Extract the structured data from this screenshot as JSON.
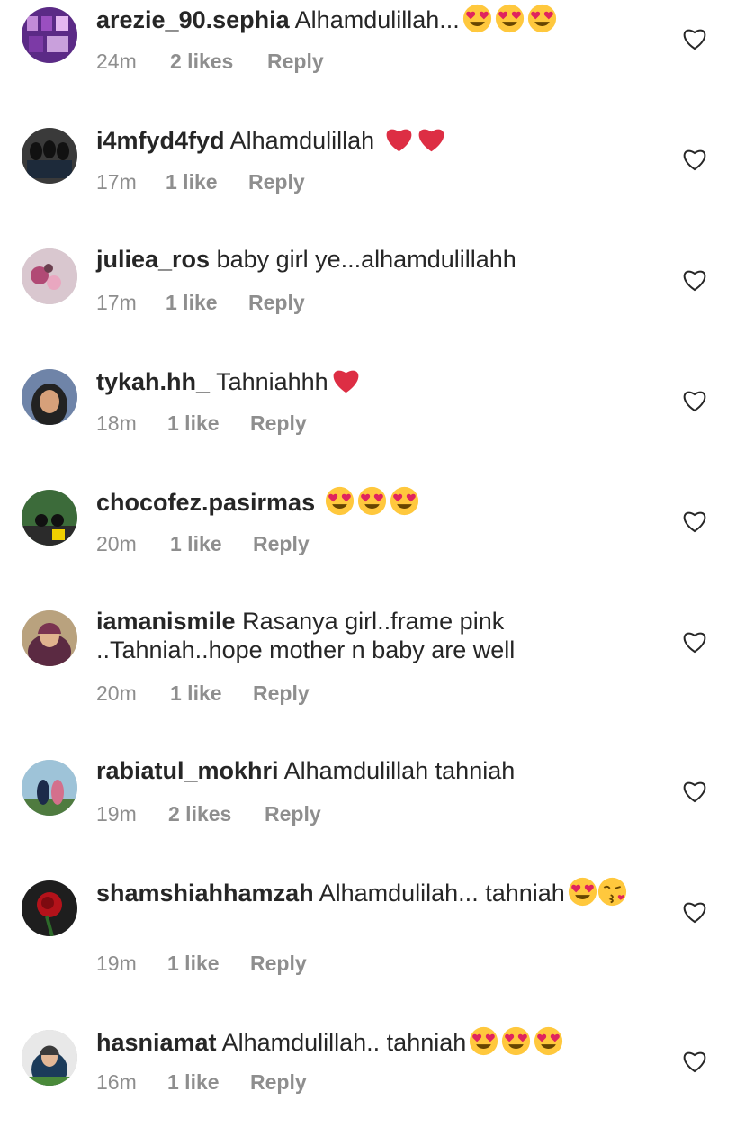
{
  "comments": [
    {
      "username": "arezie_90.sephia",
      "text": "Alhamdulillah...",
      "emojis": [
        "heart-eyes",
        "heart-eyes",
        "heart-eyes"
      ],
      "time": "24m",
      "likes": "2 likes",
      "reply": "Reply"
    },
    {
      "username": "i4mfyd4fyd",
      "text": "Alhamdulillah ",
      "emojis": [
        "red-heart",
        "red-heart"
      ],
      "time": "17m",
      "likes": "1 like",
      "reply": "Reply"
    },
    {
      "username": "juliea_ros",
      "text": "baby girl ye...alhamdulillahh",
      "emojis": [],
      "time": "17m",
      "likes": "1 like",
      "reply": "Reply"
    },
    {
      "username": "tykah.hh_",
      "text": "Tahniahhh",
      "emojis": [
        "red-heart"
      ],
      "time": "18m",
      "likes": "1 like",
      "reply": "Reply"
    },
    {
      "username": "chocofez.pasirmas",
      "text": "",
      "emojis": [
        "heart-eyes",
        "heart-eyes",
        "heart-eyes"
      ],
      "time": "20m",
      "likes": "1 like",
      "reply": "Reply"
    },
    {
      "username": "iamanismile",
      "text": "Rasanya girl..frame pink ..Tahniah..hope mother n baby are well",
      "emojis": [],
      "time": "20m",
      "likes": "1 like",
      "reply": "Reply"
    },
    {
      "username": "rabiatul_mokhri",
      "text": "Alhamdulillah tahniah",
      "emojis": [],
      "time": "19m",
      "likes": "2 likes",
      "reply": "Reply"
    },
    {
      "username": "shamshiahhamzah",
      "text": "Alhamdulilah... tahniah",
      "emojis": [
        "heart-eyes",
        "kissing-heart"
      ],
      "time": "19m",
      "likes": "1 like",
      "reply": "Reply"
    },
    {
      "username": "hasniamat",
      "text": "Alhamdulillah.. tahniah",
      "emojis": [
        "heart-eyes",
        "heart-eyes",
        "heart-eyes"
      ],
      "time": "16m",
      "likes": "1 like",
      "reply": "Reply"
    }
  ],
  "colors": {
    "text": "#262626",
    "meta": "#8e8e8e",
    "emoji_face": "#ffc83d",
    "emoji_heart": "#e0245e",
    "red_heart": "#dd2e44"
  }
}
